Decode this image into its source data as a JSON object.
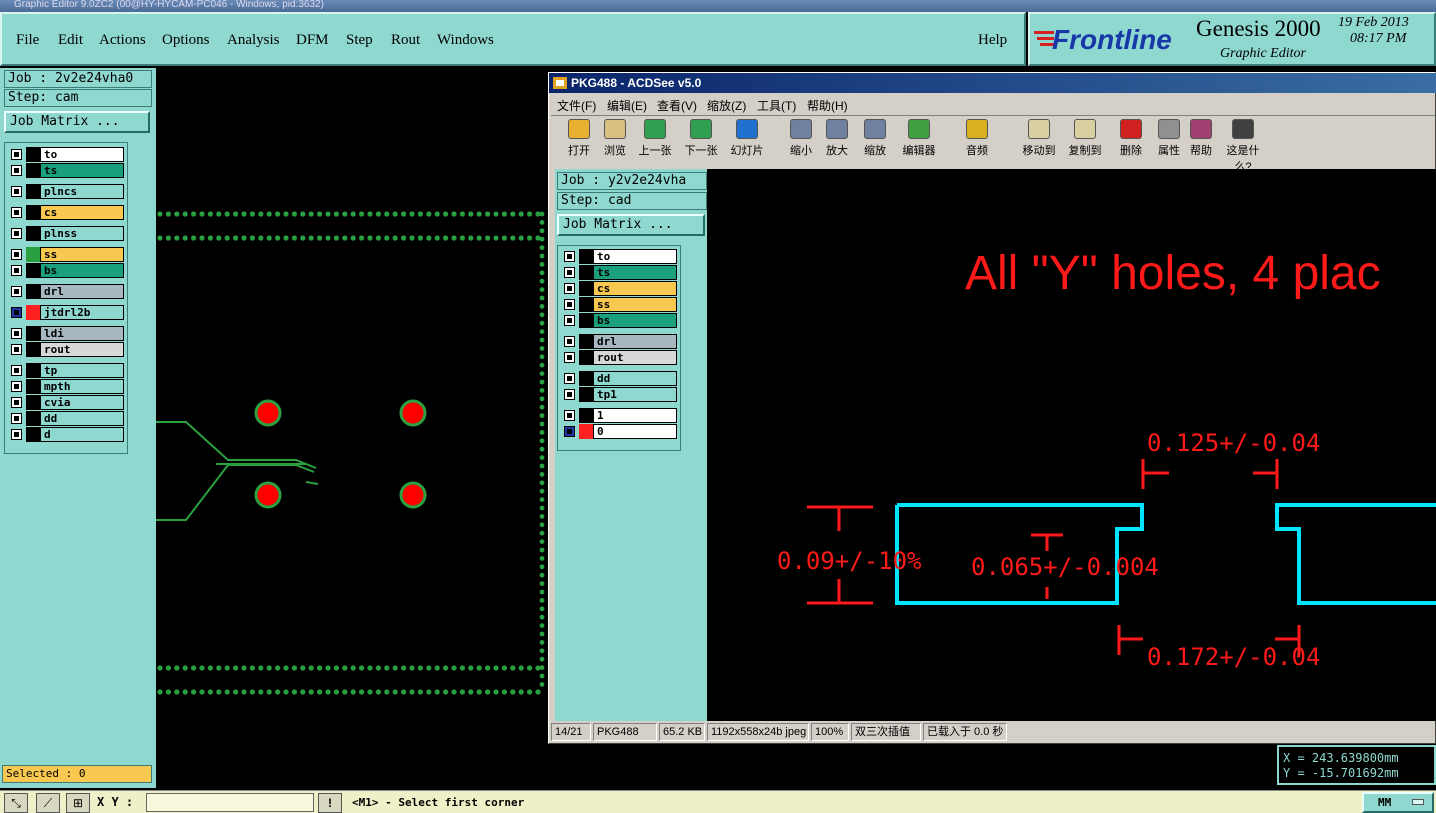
{
  "window_title": "Graphic Editor 9.0ZC2 (00@HY-HYCAM-PC046 - Windows, pid:3632)",
  "menu": [
    "File",
    "Edit",
    "Actions",
    "Options",
    "Analysis",
    "DFM",
    "Step",
    "Rout",
    "Windows"
  ],
  "help_label": "Help",
  "brand": {
    "logo": "Frontline",
    "product": "Genesis 2000",
    "subtitle": "Graphic Editor",
    "date": "19 Feb 2013",
    "time": "08:17 PM"
  },
  "left_panel": {
    "job": "Job : 2v2e24vha0",
    "step": "Step: cam",
    "matrix_button": "Job Matrix ...",
    "layers": [
      {
        "name": "to",
        "color": "#ffffff"
      },
      {
        "name": "ts",
        "color": "#1aa07c"
      },
      {
        "name": "plncs",
        "color": "#8fd8d0"
      },
      {
        "name": "cs",
        "color": "#f8c850"
      },
      {
        "name": "plnss",
        "color": "#8fd8d0"
      },
      {
        "name": "ss",
        "color": "#f8c850"
      },
      {
        "name": "bs",
        "color": "#1aa07c"
      },
      {
        "name": "drl",
        "color": "#a8b8c0"
      },
      {
        "name": "jtdrl2b",
        "color": "#8fd8d0"
      },
      {
        "name": "ldi",
        "color": "#a8b8c0"
      },
      {
        "name": "rout",
        "color": "#d8d8d8"
      },
      {
        "name": "tp",
        "color": "#8fd8d0"
      },
      {
        "name": "mpth",
        "color": "#8fd8d0"
      },
      {
        "name": "cvia",
        "color": "#8fd8d0"
      },
      {
        "name": "dd",
        "color": "#8fd8d0"
      },
      {
        "name": "d",
        "color": "#8fd8d0"
      }
    ],
    "selected": "Selected : 0"
  },
  "acdsee": {
    "title": "PKG488 - ACDSee v5.0",
    "menu": [
      "文件(F)",
      "编辑(E)",
      "查看(V)",
      "缩放(Z)",
      "工具(T)",
      "帮助(H)"
    ],
    "toolbar": [
      "打开",
      "浏览",
      "上一张",
      "下一张",
      "幻灯片",
      "缩小",
      "放大",
      "缩放",
      "编辑器",
      "音频",
      "移动到",
      "复制到",
      "删除",
      "属性",
      "帮助",
      "这是什么?"
    ],
    "status": [
      "14/21",
      "PKG488",
      "65.2 KB",
      "1192x558x24b jpeg",
      "100%",
      "双三次插值",
      "已载入于 0.0 秒"
    ],
    "inner_panel": {
      "job": "Job : y2v2e24vha",
      "step": "Step: cad",
      "matrix_button": "Job Matrix ...",
      "layers": [
        {
          "name": "to",
          "color": "#ffffff"
        },
        {
          "name": "ts",
          "color": "#1aa07c"
        },
        {
          "name": "cs",
          "color": "#f8c850"
        },
        {
          "name": "ss",
          "color": "#f8c850"
        },
        {
          "name": "bs",
          "color": "#1aa07c"
        },
        {
          "name": "drl",
          "color": "#a8b8c0"
        },
        {
          "name": "rout",
          "color": "#d8d8d8"
        },
        {
          "name": "dd",
          "color": "#8fd8d0"
        },
        {
          "name": "tp1",
          "color": "#8fd8d0"
        },
        {
          "name": "1",
          "color": "#ffffff"
        },
        {
          "name": "0",
          "color": "#ffffff"
        }
      ]
    },
    "drawing": {
      "heading": "All \"Y\" holes, 4 plac",
      "dim_a": "0.125+/-0.04",
      "dim_b": "0.09+/-10%",
      "dim_c": "0.065+/-0.004",
      "dim_d": "0.172+/-0.04"
    }
  },
  "coords": {
    "x": "X = 243.639800mm",
    "y": "Y = -15.701692mm"
  },
  "statusbar": {
    "xy_label": "X Y :",
    "prompt": "<M1> - Select first corner",
    "units": "MM"
  }
}
